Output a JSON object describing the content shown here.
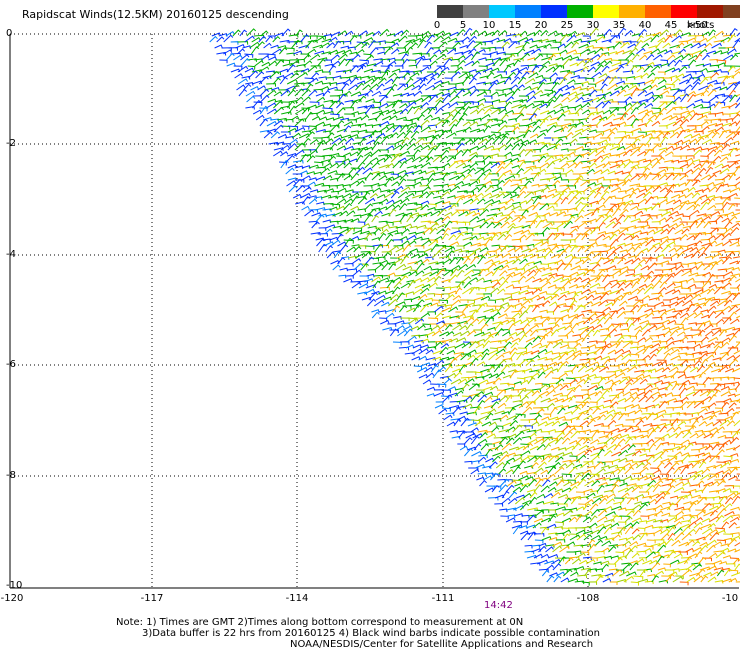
{
  "title": "Rapidscat Winds(12.5KM) 20160125 descending",
  "legend": {
    "ticks": [
      "0",
      "5",
      "10",
      "15",
      "20",
      "25",
      "30",
      "35",
      "40",
      "45",
      ">50"
    ],
    "units": "knots",
    "colors": [
      "#404040",
      "#808080",
      "#00c8ff",
      "#0080ff",
      "#0030ff",
      "#00b000",
      "#ffff00",
      "#ffb000",
      "#ff6000",
      "#ff0000",
      "#a01800",
      "#804020",
      "#ff00ff",
      "#9000ff",
      "#500090"
    ]
  },
  "chart_data": {
    "type": "wind-barb map",
    "x_ticks": [
      "-120",
      "-117",
      "-114",
      "-111",
      "-108",
      "-10"
    ],
    "y_ticks": [
      "0",
      "-2",
      "-4",
      "-6",
      "-8",
      "-10"
    ],
    "xlim": [
      -120,
      -108
    ],
    "ylim": [
      -10,
      0
    ],
    "grid": true,
    "time_label": "14:42"
  },
  "notes": {
    "line1": "Note: 1) Times are GMT 2)Times along bottom correspond to measurement at 0N",
    "line2": "3)Data buffer is 22 hrs from 20160125 4) Black wind barbs indicate possible contamination",
    "line3": "NOAA/NESDIS/Center for Satellite Applications and Research"
  }
}
